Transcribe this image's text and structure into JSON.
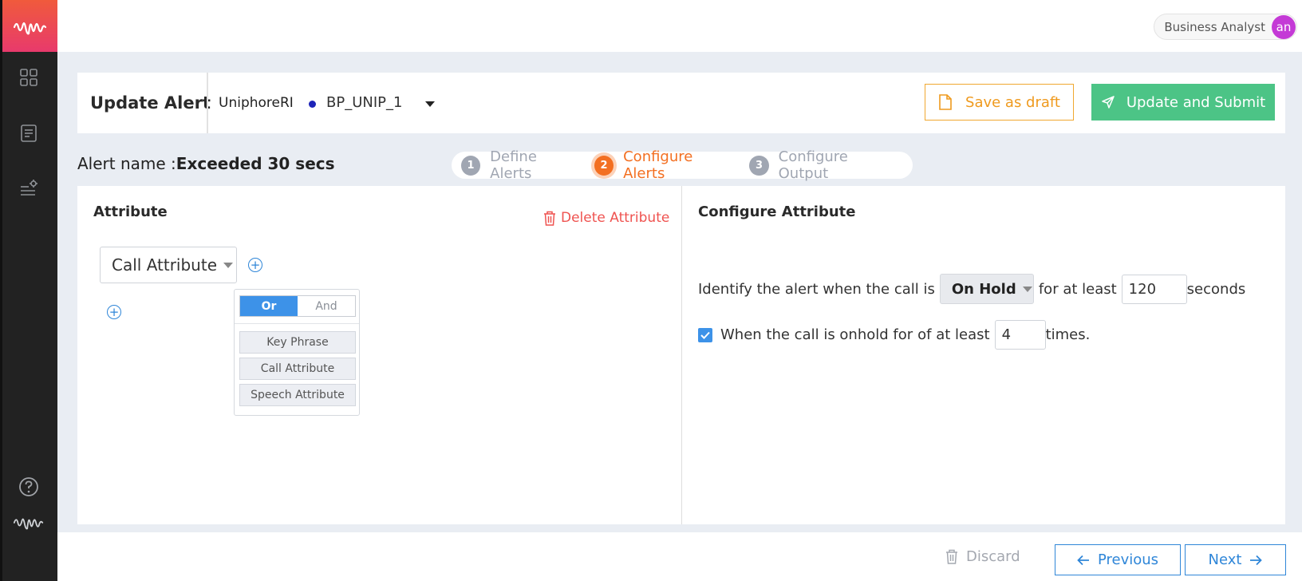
{
  "header": {
    "title": "Update Alert",
    "org": "UniphoreRI",
    "project": "BP_UNIP_1",
    "save_draft_label": "Save as draft",
    "submit_label": "Update and Submit"
  },
  "user": {
    "role": "Business Analyst",
    "initials": "an"
  },
  "alert": {
    "name_label": "Alert name :",
    "name_value": "Exceeded 30 secs"
  },
  "stepper": {
    "steps": [
      {
        "num": "1",
        "label": "Define Alerts"
      },
      {
        "num": "2",
        "label": "Configure Alerts"
      },
      {
        "num": "3",
        "label": "Configure Output"
      }
    ],
    "active_step": 2
  },
  "attribute_panel": {
    "title": "Attribute",
    "delete_label": "Delete Attribute",
    "selected_attribute": "Call Attribute",
    "popover": {
      "or_label": "Or",
      "and_label": "And",
      "selected_logic": "Or",
      "items": [
        "Key Phrase",
        "Call Attribute",
        "Speech Attribute"
      ]
    }
  },
  "configure_panel": {
    "title": "Configure Attribute",
    "row1_prefix": "Identify the alert when the call is",
    "state_value": "On Hold",
    "row1_mid": "for at least",
    "seconds_value": "120",
    "row1_suffix": "seconds",
    "row2_checked": true,
    "row2_prefix": "When the call is onhold for",
    "row2_mid": "of at least",
    "times_value": "4",
    "row2_suffix": "times."
  },
  "footer": {
    "discard_label": "Discard",
    "previous_label": "Previous",
    "next_label": "Next"
  },
  "colors": {
    "accent_orange": "#f36f21",
    "submit_green": "#4cc486",
    "primary_blue": "#2f86d8",
    "danger_red": "#ef5350"
  }
}
